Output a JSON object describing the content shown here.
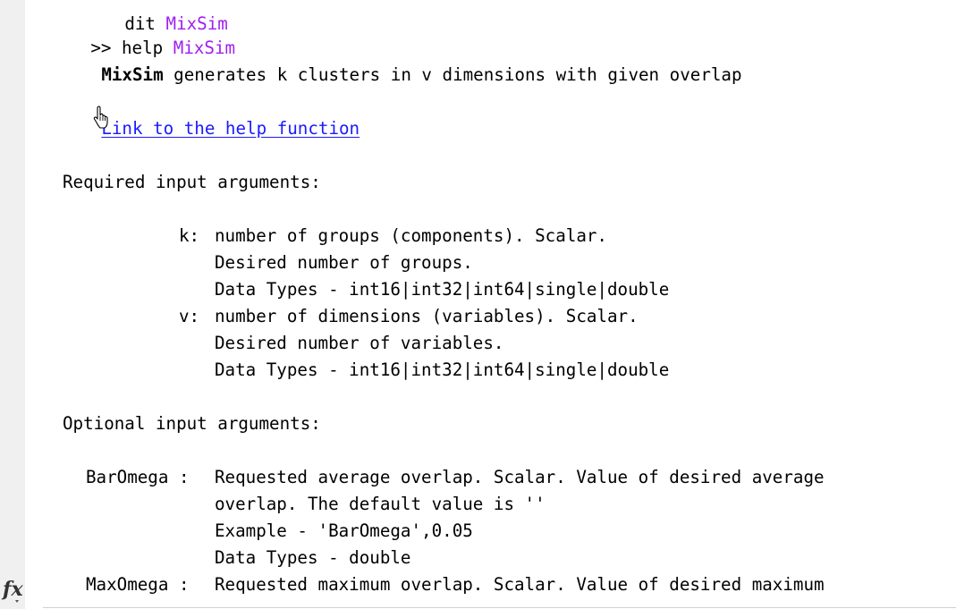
{
  "console": {
    "partial_top": {
      "text": "   ..."
    },
    "prompt": {
      "symbol": ">>",
      "command": "help",
      "argument": "MixSim"
    },
    "summary": {
      "name": "MixSim",
      "text": " generates k clusters in v dimensions with given overlap"
    },
    "help_link": "Link to the help function",
    "required_header": "Required input arguments:",
    "required_args": [
      {
        "label": "k:",
        "lines": [
          "number of groups (components). Scalar.",
          "Desired number of groups.",
          "Data Types - int16|int32|int64|single|double"
        ]
      },
      {
        "label": "v:",
        "lines": [
          "number of dimensions (variables). Scalar.",
          "Desired number of variables.",
          "Data Types - int16|int32|int64|single|double"
        ]
      }
    ],
    "optional_header": "Optional input arguments:",
    "optional_args": [
      {
        "label": "BarOmega :",
        "lines": [
          "Requested average overlap. Scalar. Value of desired average",
          "overlap. The default value is ''",
          "Example - 'BarOmega',0.05",
          "Data Types - double"
        ]
      },
      {
        "label": "MaxOmega :",
        "lines": [
          "Requested maximum overlap. Scalar. Value of desired maximum"
        ]
      }
    ],
    "colors": {
      "keyword": "#a020f0",
      "link": "#1a1aff"
    }
  },
  "command_line": {
    "icon": "fx-icon",
    "label": "fx"
  }
}
